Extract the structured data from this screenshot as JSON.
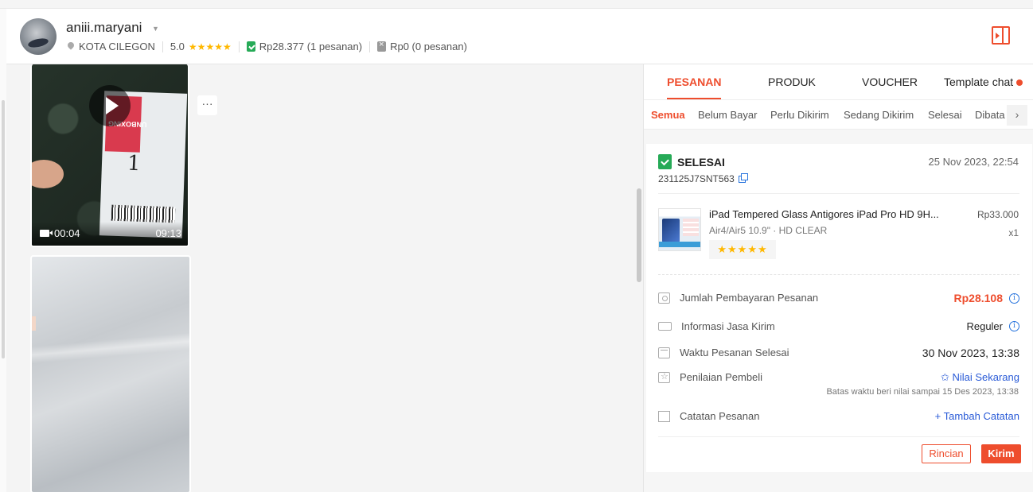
{
  "header": {
    "username": "aniii.maryani",
    "location": "KOTA CILEGON",
    "rating": "5.0",
    "rating_stars": "★★★★★",
    "paid_total": "Rp28.377 (1 pesanan)",
    "unpaid_total": "Rp0 (0 pesanan)",
    "icons": [
      "location-pin-icon",
      "star-icon",
      "green-clipboard-icon",
      "gray-clipboard-icon",
      "panel-toggle-icon"
    ]
  },
  "chat": {
    "video": {
      "current_time": "00:04",
      "duration": "09:13"
    },
    "more_label": "···"
  },
  "side": {
    "tabs": [
      {
        "label": "PESANAN",
        "active": true
      },
      {
        "label": "PRODUK"
      },
      {
        "label": "VOUCHER"
      },
      {
        "label": "Template chat"
      }
    ],
    "subtabs": [
      "Semua",
      "Belum Bayar",
      "Perlu Dikirim",
      "Sedang Dikirim",
      "Selesai",
      "Dibata"
    ],
    "subtab_arrow": "›",
    "order": {
      "status": "SELESAI",
      "date": "25 Nov 2023, 22:54",
      "order_id": "231125J7SNT563",
      "product_name": "iPad Tempered Glass Antigores iPad Pro HD 9H...",
      "product_price": "Rp33.000",
      "variation": "Air4/Air5 10.9\" · HD CLEAR",
      "quantity": "x1",
      "rating_stars": "★★★★★",
      "rows": {
        "payment_label": "Jumlah Pembayaran Pesanan",
        "payment_value": "Rp28.108",
        "shipping_label": "Informasi Jasa Kirim",
        "shipping_value": "Reguler",
        "completed_label": "Waktu Pesanan Selesai",
        "completed_value": "30 Nov 2023, 13:38",
        "review_label": "Penilaian Pembeli",
        "review_action": "✩ Nilai Sekarang",
        "review_deadline": "Batas waktu beri nilai sampai 15 Des 2023, 13:38",
        "notes_label": "Catatan Pesanan",
        "notes_action": "+ Tambah Catatan"
      },
      "detail_button": "Rincian",
      "send_button": "Kirim"
    },
    "accent_color": "#ee4d2d"
  }
}
